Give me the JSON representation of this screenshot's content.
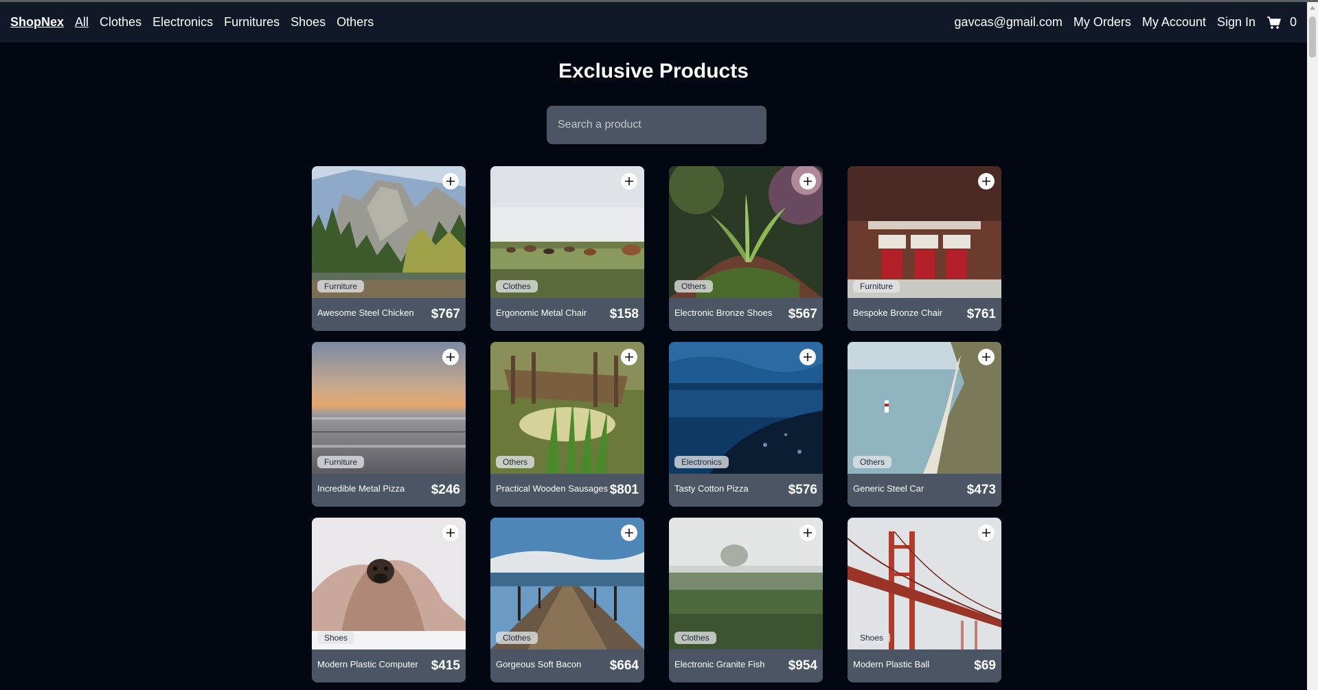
{
  "nav": {
    "brand": "ShopNex",
    "links": [
      "All",
      "Clothes",
      "Electronics",
      "Furnitures",
      "Shoes",
      "Others"
    ],
    "email": "gavcas@gmail.com",
    "my_orders": "My Orders",
    "my_account": "My Account",
    "sign_in": "Sign In",
    "cart_icon": "cart-icon",
    "cart_count": "0"
  },
  "page": {
    "title": "Exclusive Products",
    "search_placeholder": "Search a product"
  },
  "products": [
    {
      "name": "Awesome Steel Chicken",
      "price": "$767",
      "category": "Furniture",
      "image": "mountain-valley"
    },
    {
      "name": "Ergonomic Metal Chair",
      "price": "$158",
      "category": "Clothes",
      "image": "horses-meadow"
    },
    {
      "name": "Electronic Bronze Shoes",
      "price": "$567",
      "category": "Others",
      "image": "plant-closeup"
    },
    {
      "name": "Bespoke Bronze Chair",
      "price": "$761",
      "category": "Furniture",
      "image": "brick-hall"
    },
    {
      "name": "Incredible Metal Pizza",
      "price": "$246",
      "category": "Furniture",
      "image": "sunset-sea"
    },
    {
      "name": "Practical Wooden Sausages",
      "price": "$801",
      "category": "Others",
      "image": "wooden-dock"
    },
    {
      "name": "Tasty Cotton Pizza",
      "price": "$576",
      "category": "Electronics",
      "image": "blue-shore"
    },
    {
      "name": "Generic Steel Car",
      "price": "$473",
      "category": "Others",
      "image": "cliff-lighthouse"
    },
    {
      "name": "Modern Plastic Computer",
      "price": "$415",
      "category": "Shoes",
      "image": "pug-blanket"
    },
    {
      "name": "Gorgeous Soft Bacon",
      "price": "$664",
      "category": "Clothes",
      "image": "pier"
    },
    {
      "name": "Electronic Granite Fish",
      "price": "$954",
      "category": "Clothes",
      "image": "foggy-field"
    },
    {
      "name": "Modern Plastic Ball",
      "price": "$69",
      "category": "Shoes",
      "image": "red-bridge"
    }
  ],
  "colors": {
    "background": "#030712",
    "navbar": "#111827",
    "card": "#4b5563",
    "search": "#4b5563"
  }
}
